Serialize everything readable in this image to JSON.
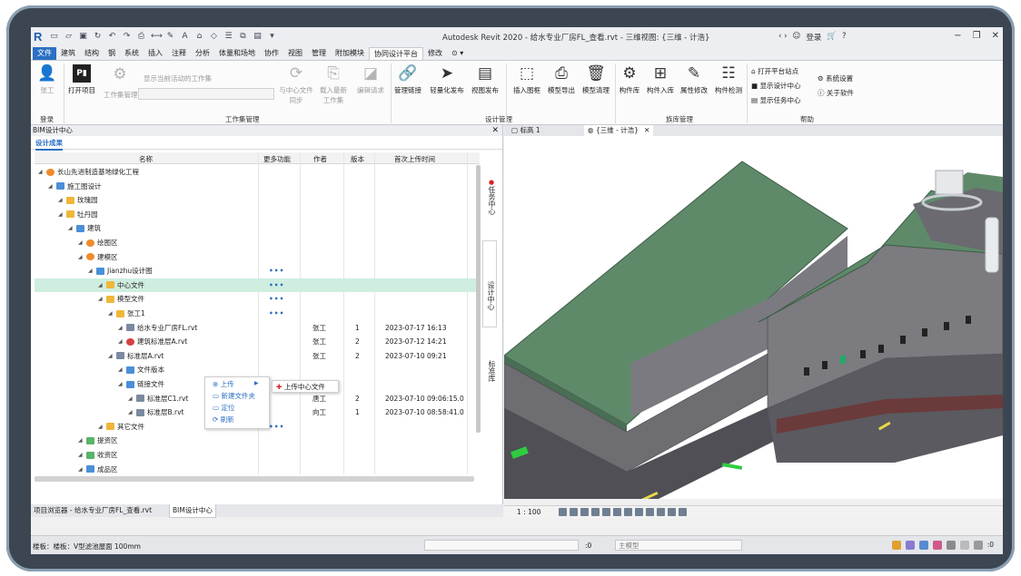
{
  "app": {
    "title": "Autodesk Revit 2020 - 给水专业厂房FL_查看.rvt - 三维视图: {三维 - 计浩}",
    "user": "登录",
    "help": "?"
  },
  "ribbon_tabs": [
    "文件",
    "建筑",
    "结构",
    "钢",
    "系统",
    "插入",
    "注释",
    "分析",
    "体量和场地",
    "协作",
    "视图",
    "管理",
    "附加模块",
    "协同设计平台",
    "修改"
  ],
  "ribbon": {
    "login": {
      "user_label": "张工",
      "group": "登录"
    },
    "workset": {
      "open_project": "打开项目",
      "workset_mgmt": "工作集管理",
      "show_active": "显示当前活动的工作集",
      "sync": "与中心文件\n同步",
      "load_latest": "载入最新\n工作集",
      "edit_request": "编辑请求",
      "group": "工作集管理"
    },
    "design": {
      "items": [
        "管理链接",
        "轻量化发布",
        "视图发布"
      ],
      "group": "设计管理"
    },
    "lib_left": {
      "items": [
        "插入图框",
        "模型导出",
        "模型清理"
      ]
    },
    "library": {
      "items": [
        "构件库",
        "构件入库",
        "属性修改",
        "构件检测"
      ],
      "group": "族库管理"
    },
    "help": {
      "items": [
        "打开平台站点",
        "显示设计中心",
        "显示任务中心",
        "系统设置",
        "关于软件"
      ],
      "group": "帮助"
    }
  },
  "panel": {
    "title": "BIM设计中心",
    "subtab": "设计成果",
    "columns": [
      "名称",
      "更多功能",
      "作者",
      "版本",
      "首次上传时间"
    ],
    "rows": [
      {
        "name": "长山先进制造基地绿化工程",
        "indent": 0,
        "icon": "orange",
        "more": "",
        "author": "",
        "version": "",
        "date": "",
        "extra": ""
      },
      {
        "name": "施工图设计",
        "indent": 1,
        "icon": "blue",
        "more": "",
        "author": "",
        "version": "",
        "date": "",
        "extra": ""
      },
      {
        "name": "玫瑰园",
        "indent": 2,
        "icon": "folder",
        "more": "",
        "author": "",
        "version": "",
        "date": "",
        "extra": ""
      },
      {
        "name": "牡丹园",
        "indent": 2,
        "icon": "folder",
        "more": "",
        "author": "",
        "version": "",
        "date": "",
        "extra": ""
      },
      {
        "name": "建筑",
        "indent": 3,
        "icon": "blue",
        "more": "",
        "author": "",
        "version": "",
        "date": "",
        "extra": ""
      },
      {
        "name": "绘图区",
        "indent": 4,
        "icon": "orange",
        "more": "",
        "author": "",
        "version": "",
        "date": "",
        "extra": ""
      },
      {
        "name": "建模区",
        "indent": 4,
        "icon": "orange",
        "more": "",
        "author": "",
        "version": "",
        "date": "",
        "extra": ""
      },
      {
        "name": "Jianzhu设计图",
        "indent": 5,
        "icon": "blue",
        "more": "•••",
        "author": "",
        "version": "",
        "date": "",
        "extra": ""
      },
      {
        "name": "中心文件",
        "indent": 6,
        "icon": "folder",
        "more": "•••",
        "author": "",
        "version": "",
        "date": "",
        "extra": "",
        "highlight": true
      },
      {
        "name": "模型文件",
        "indent": 6,
        "icon": "folder",
        "more": "•••",
        "author": "",
        "version": "",
        "date": "",
        "extra": ""
      },
      {
        "name": "张工1",
        "indent": 7,
        "icon": "folder",
        "more": "•••",
        "author": "",
        "version": "",
        "date": "",
        "extra": ""
      },
      {
        "name": "给水专业厂房FL.rvt",
        "indent": 8,
        "icon": "file",
        "more": "",
        "author": "张工",
        "version": "1",
        "date": "2023-07-17 16:13",
        "extra": "2"
      },
      {
        "name": "建筑标准层A.rvt",
        "indent": 8,
        "icon": "red",
        "more": "",
        "author": "张工",
        "version": "2",
        "date": "2023-07-12 14:21",
        "extra": "2"
      },
      {
        "name": "标准层A.rvt",
        "indent": 7,
        "icon": "file",
        "more": "",
        "author": "张工",
        "version": "2",
        "date": "2023-07-10 09:21",
        "extra": "2"
      },
      {
        "name": "文件版本",
        "indent": 8,
        "icon": "blue",
        "more": "",
        "author": "",
        "version": "",
        "date": "",
        "extra": ""
      },
      {
        "name": "链接文件",
        "indent": 8,
        "icon": "blue",
        "more": "",
        "author": "",
        "version": "",
        "date": "",
        "extra": ""
      },
      {
        "name": "标准层C1.rvt",
        "indent": 9,
        "icon": "file",
        "more": "",
        "author": "唐工",
        "version": "2",
        "date": "2023-07-10 09:06:15.0",
        "extra": ""
      },
      {
        "name": "标准层B.rvt",
        "indent": 9,
        "icon": "file",
        "more": "",
        "author": "向工",
        "version": "1",
        "date": "2023-07-10 08:58:41.0",
        "extra": ""
      },
      {
        "name": "其它文件",
        "indent": 6,
        "icon": "folder",
        "more": "•••",
        "author": "",
        "version": "",
        "date": "",
        "extra": ""
      },
      {
        "name": "提资区",
        "indent": 4,
        "icon": "green",
        "more": "",
        "author": "",
        "version": "",
        "date": "",
        "extra": ""
      },
      {
        "name": "收资区",
        "indent": 4,
        "icon": "green",
        "more": "",
        "author": "",
        "version": "",
        "date": "",
        "extra": ""
      },
      {
        "name": "成品区",
        "indent": 4,
        "icon": "blue",
        "more": "",
        "author": "",
        "version": "",
        "date": "",
        "extra": ""
      }
    ],
    "context_menu": [
      "上传",
      "新建文件夹",
      "定位",
      "刷新"
    ],
    "context_submenu": "上传中心文件",
    "side_tabs": [
      "任务中心",
      "设计中心",
      "标准库"
    ],
    "bottom_tabs": [
      "项目浏览器 - 给水专业厂房FL_查看.rvt",
      "BIM设计中心"
    ]
  },
  "view": {
    "tabs": [
      "标高 1",
      "{三维 - 计浩}"
    ],
    "scale": "1 : 100",
    "cube_label": "右"
  },
  "statusbar": {
    "text": "楼板：楼板：V型滤池屋面 100mm",
    "zero": ":0",
    "model": "主模型",
    "filter": ":0"
  },
  "colors": {
    "accent": "#2b6fc3",
    "roof": "#5f8a6a",
    "highlight": "#cfeee0"
  }
}
